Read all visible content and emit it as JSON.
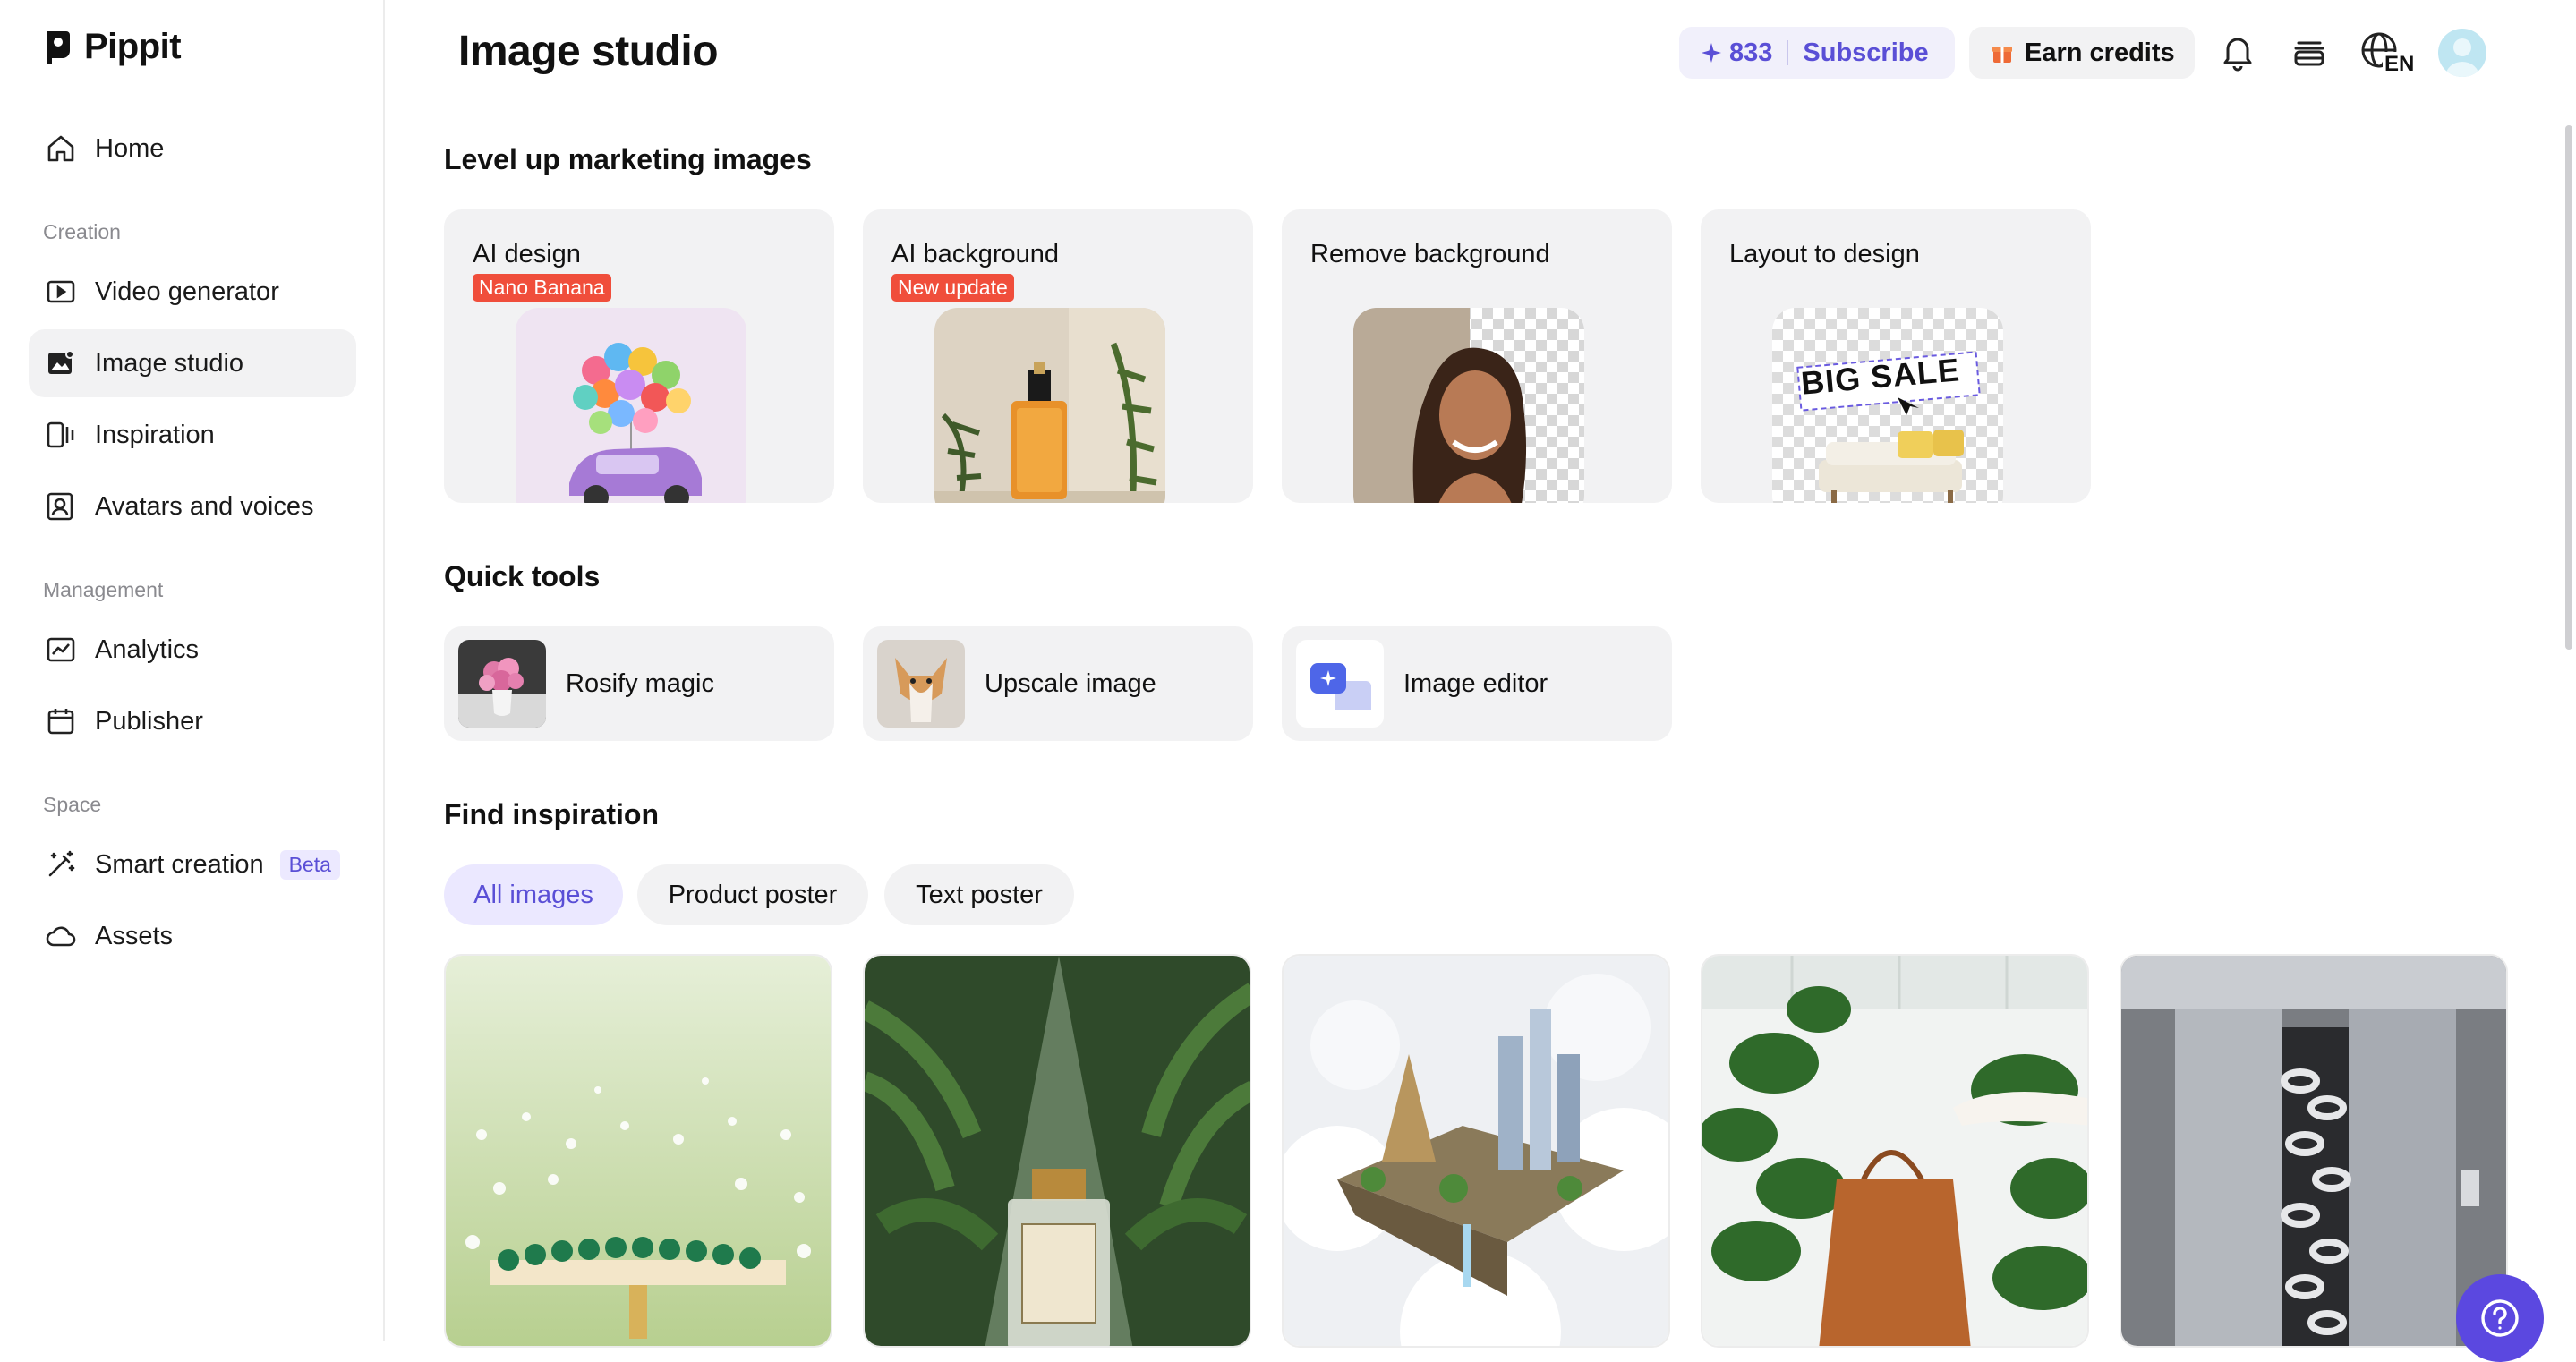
{
  "app": {
    "name": "Pippit"
  },
  "sidebar": {
    "home": "Home",
    "sections": {
      "creation": "Creation",
      "management": "Management",
      "space": "Space"
    },
    "creation_items": [
      {
        "label": "Video generator",
        "icon": "video-generator-icon"
      },
      {
        "label": "Image studio",
        "icon": "image-studio-icon",
        "active": true
      },
      {
        "label": "Inspiration",
        "icon": "inspiration-icon"
      },
      {
        "label": "Avatars and voices",
        "icon": "avatar-icon"
      }
    ],
    "management_items": [
      {
        "label": "Analytics",
        "icon": "analytics-icon"
      },
      {
        "label": "Publisher",
        "icon": "calendar-icon"
      }
    ],
    "space_items": [
      {
        "label": "Smart creation",
        "icon": "magic-wand-icon",
        "badge": "Beta"
      },
      {
        "label": "Assets",
        "icon": "cloud-icon"
      }
    ]
  },
  "header": {
    "title": "Image studio",
    "credits": "833",
    "subscribe": "Subscribe",
    "earn_credits": "Earn credits",
    "language": "EN"
  },
  "marketing": {
    "title": "Level up marketing images",
    "cards": [
      {
        "title": "AI design",
        "badge": "Nano Banana"
      },
      {
        "title": "AI background",
        "badge": "New update"
      },
      {
        "title": "Remove background"
      },
      {
        "title": "Layout to design",
        "art_text": "BIG SALE"
      }
    ]
  },
  "quick_tools": {
    "title": "Quick tools",
    "items": [
      {
        "label": "Rosify magic"
      },
      {
        "label": "Upscale image"
      },
      {
        "label": "Image editor"
      }
    ]
  },
  "inspiration": {
    "title": "Find inspiration",
    "filters": [
      {
        "label": "All images",
        "active": true
      },
      {
        "label": "Product poster"
      },
      {
        "label": "Text poster"
      }
    ]
  },
  "colors": {
    "accent": "#5a4fd6",
    "badge_red": "#f04e3b",
    "card_bg": "#f2f2f3"
  }
}
